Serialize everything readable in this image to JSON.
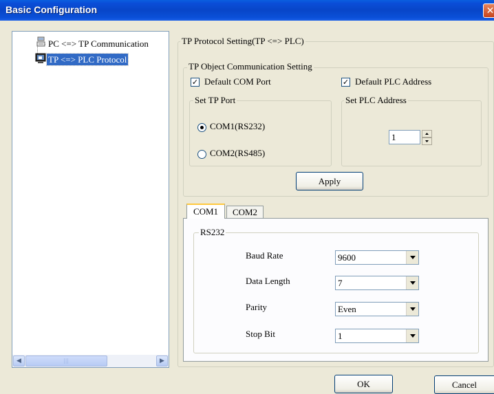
{
  "window": {
    "title": "Basic Configuration",
    "close_glyph": "✕"
  },
  "tree": {
    "items": [
      {
        "label": "PC <=> TP Communication",
        "icon": "computer-icon"
      },
      {
        "label": "TP <=> PLC Protocol",
        "icon": "monitor-icon",
        "selected": true
      }
    ],
    "scroll_thumb": "|||"
  },
  "protocol": {
    "group_label": "TP Protocol Setting(TP <=> PLC)",
    "object_comm": {
      "group_label": "TP Object Communication Setting",
      "default_com_port": {
        "label": "Default COM Port",
        "checked": true
      },
      "default_plc_address": {
        "label": "Default PLC Address",
        "checked": true
      },
      "set_tp_port": {
        "group_label": "Set TP Port",
        "options": [
          {
            "label": "COM1(RS232)",
            "selected": true
          },
          {
            "label": "COM2(RS485)",
            "selected": false
          }
        ]
      },
      "set_plc_address": {
        "group_label": "Set PLC Address",
        "value": "1"
      },
      "apply_label": "Apply"
    },
    "tabs": [
      {
        "label": "COM1",
        "active": true
      },
      {
        "label": "COM2",
        "active": false
      }
    ],
    "rs232": {
      "group_label": "RS232",
      "fields": [
        {
          "label": "Baud Rate",
          "value": "9600"
        },
        {
          "label": "Data Length",
          "value": "7"
        },
        {
          "label": "Parity",
          "value": "Even"
        },
        {
          "label": "Stop Bit",
          "value": "1"
        }
      ]
    }
  },
  "footer": {
    "ok_label": "OK",
    "cancel_label": "Cancel"
  },
  "colors": {
    "titlebar": "#0a4ed8",
    "dialog_bg": "#ece9d8",
    "selection": "#316ac5"
  }
}
